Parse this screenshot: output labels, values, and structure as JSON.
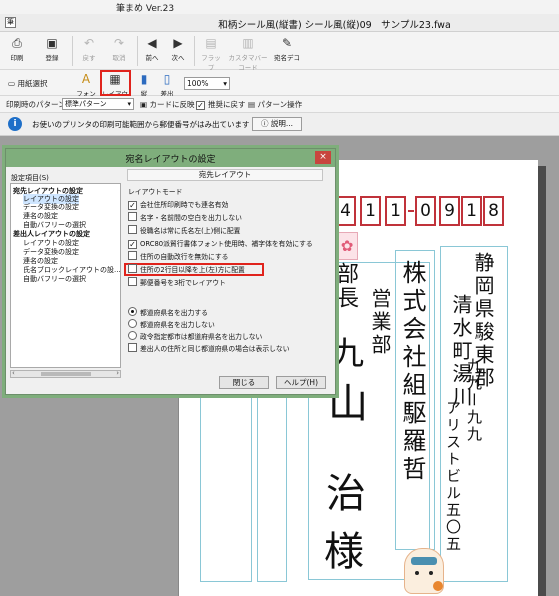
{
  "app": {
    "title": "筆まめ Ver.23"
  },
  "window": {
    "title": "和柄シール風(縦書) シール風(縦)09　サンプル23.fwa"
  },
  "toolbar1": {
    "print": "印刷",
    "register": "登録",
    "undo": "戻す",
    "redo": "取消",
    "prev": "前へ",
    "next": "次へ",
    "flap": "フラップ",
    "custom_barcode": "カスタマバーコード",
    "address_deco": "宛名デコ"
  },
  "toolbar2": {
    "paper_select": "用紙選択",
    "font": "フォント",
    "layout": "レイアウト",
    "vertical": "縦",
    "horizontal": "差出",
    "zoom": "100%"
  },
  "toolbar3": {
    "print_pattern_label": "印刷時のパターン",
    "print_pattern_value": "標準パターン",
    "reflect_card": "カードに反映",
    "show_recommended": "推奨に戻す",
    "pattern_ops": "パターン操作"
  },
  "infobar": {
    "message": "お使いのプリンタの印刷可能範囲から郵便番号がはみ出ています",
    "help_button": "説明..."
  },
  "postcard": {
    "zip": [
      "4",
      "1",
      "1",
      "0",
      "9",
      "1",
      "8"
    ],
    "recipient_address": [
      "静岡県駿東郡",
      "清水町湯川",
      "九九ー九九",
      "アリストビル五〇五"
    ],
    "company": [
      "株式会社組駆羅哲",
      "営業部"
    ],
    "recipient_name": [
      "山",
      "治",
      "様"
    ],
    "partial_left": [
      "部",
      "長",
      "九"
    ]
  },
  "dialog": {
    "title": "宛名レイアウトの設定",
    "close": "×",
    "tree_label": "設定項目(S)",
    "tree": [
      {
        "label": "宛先レイアウトの設定",
        "kind": "head"
      },
      {
        "label": "レイアウトの設定",
        "kind": "sel"
      },
      {
        "label": "データ変換の設定",
        "kind": "child"
      },
      {
        "label": "連名の設定",
        "kind": "child"
      },
      {
        "label": "自動バフリーの選択",
        "kind": "child"
      },
      {
        "label": "差出人レイアウトの設定",
        "kind": "head"
      },
      {
        "label": "レイアウトの設定",
        "kind": "child"
      },
      {
        "label": "データ変換の設定",
        "kind": "child"
      },
      {
        "label": "連名の設定",
        "kind": "child"
      },
      {
        "label": "氏名ブロックレイアウトの設...",
        "kind": "child"
      },
      {
        "label": "自動バフリーの選択",
        "kind": "child"
      }
    ],
    "panel_title": "宛先レイアウト",
    "mode_label": "レイアウトモード",
    "options": [
      {
        "label": "会社住所印刷時でも連名有効",
        "checked": true
      },
      {
        "label": "名字・名前間の空白を出力しない",
        "checked": false
      },
      {
        "label": "役職名は常に氏名左(上)側に配置",
        "checked": false
      },
      {
        "label": "ORC80派貿行書体フォント使用時、補字体を有効にする",
        "checked": true
      },
      {
        "label": "住所の自動改行を無効にする",
        "checked": false
      },
      {
        "label": "住所の2行目以降を上(左)方に配置",
        "checked": false
      },
      {
        "label": "郵便番号を3桁でレイアウト",
        "checked": false
      }
    ],
    "radios": [
      {
        "label": "都道府県名を出力する",
        "on": true
      },
      {
        "label": "都道府県名を出力しない",
        "on": false
      },
      {
        "label": "政令指定都市は都道府県名を出力しない",
        "on": false
      }
    ],
    "last_check": "差出人の住所と同じ都道府県の場合は表示しない",
    "close_button": "閉じる",
    "help_button": "ヘルプ(H)"
  }
}
